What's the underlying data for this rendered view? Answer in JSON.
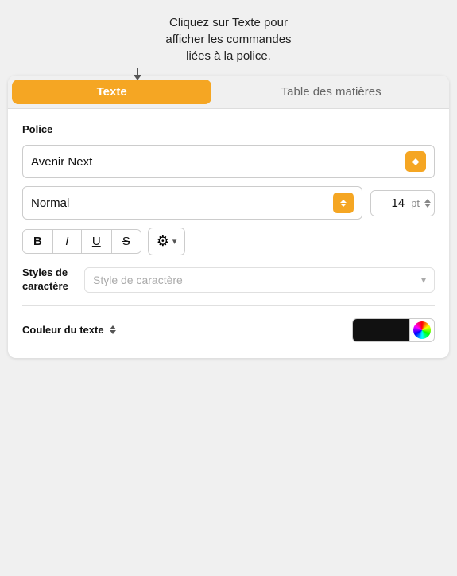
{
  "tooltip": {
    "line1": "Cliquez sur Texte pour",
    "line2": "afficher les commandes",
    "line3": "liées à la police."
  },
  "tabs": {
    "texte": "Texte",
    "toc": "Table des matières"
  },
  "font_section": {
    "label": "Police",
    "font_name": "Avenir Next",
    "font_style": "Normal",
    "font_size_value": "14",
    "font_size_unit": "pt"
  },
  "format_buttons": {
    "bold": "B",
    "italic": "I",
    "underline": "U",
    "strikethrough": "S"
  },
  "char_style": {
    "label": "Styles de\ncaractère",
    "placeholder": "Style de caractère"
  },
  "text_color": {
    "label": "Couleur du texte"
  }
}
